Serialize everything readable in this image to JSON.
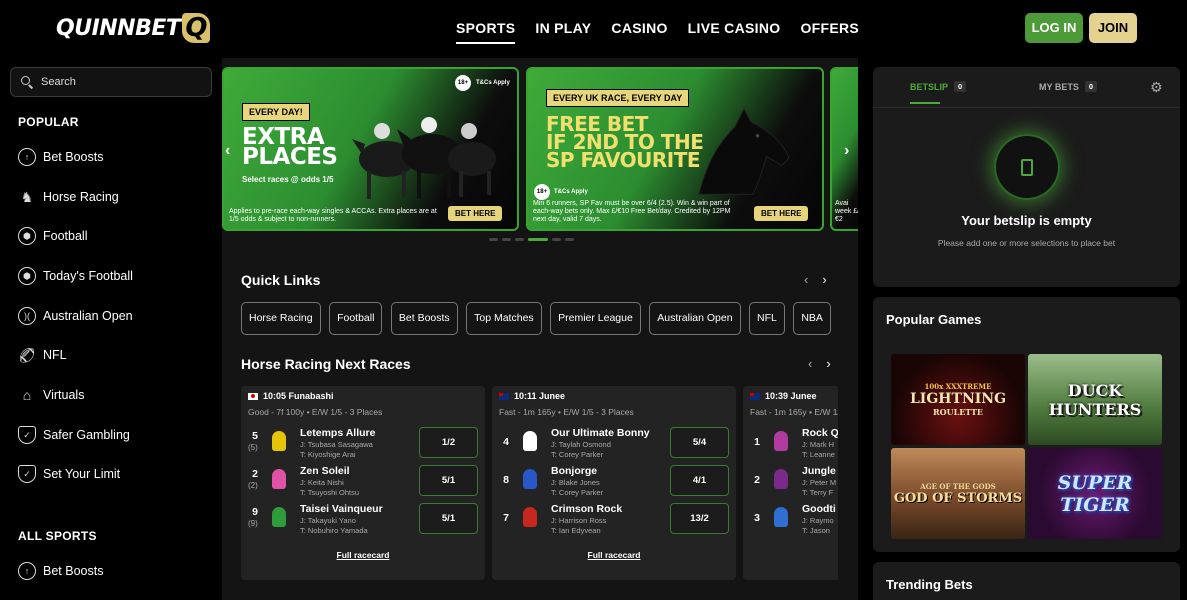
{
  "header": {
    "logo_text": "QUINNBET",
    "logo_letter": "Q",
    "nav": [
      "SPORTS",
      "IN PLAY",
      "CASINO",
      "LIVE CASINO",
      "OFFERS"
    ],
    "login_label": "LOG IN",
    "join_label": "JOIN",
    "accent_green": "#4c9a38",
    "accent_gold": "#e4d290"
  },
  "sidebar": {
    "search_placeholder": "Search",
    "popular_heading": "POPULAR",
    "popular_items": [
      {
        "label": "Bet Boosts",
        "icon": "boost-icon"
      },
      {
        "label": "Horse Racing",
        "icon": "horse-icon"
      },
      {
        "label": "Football",
        "icon": "football-icon"
      },
      {
        "label": "Today's Football",
        "icon": "football-icon"
      },
      {
        "label": "Australian Open",
        "icon": "tennis-icon"
      },
      {
        "label": "NFL",
        "icon": "american-football-icon"
      },
      {
        "label": "Virtuals",
        "icon": "virtuals-icon"
      },
      {
        "label": "Safer Gambling",
        "icon": "shield-icon"
      },
      {
        "label": "Set Your Limit",
        "icon": "shield-check-icon"
      }
    ],
    "all_sports_heading": "ALL SPORTS",
    "all_sports_items": [
      {
        "label": "Bet Boosts",
        "icon": "boost-icon"
      }
    ]
  },
  "banners": [
    {
      "tag": "EVERY DAY!",
      "title_line1": "EXTRA",
      "title_line2": "PLACES",
      "sub": "Select races @ odds 1/5",
      "terms": "Applies to pre-race each-way singles & ACCAs. Extra places are at 1/5 odds & subject to non-runners.",
      "button": "BET HERE",
      "age": "18+",
      "tc": "T&Cs Apply"
    },
    {
      "tag": "EVERY UK RACE, EVERY DAY",
      "title_line1": "FREE BET",
      "title_line2": "IF 2ND TO THE",
      "title_line3": "SP FAVOURITE",
      "terms": "Min 6 runners, SP Fav must be over 6/4 (2.5). Win & win part of each-way bets only. Max £/€10 Free Bet/day. Credited by 12PM next day, valid 7 days.",
      "button": "BET HERE",
      "age": "18+",
      "tc": "T&Cs Apply"
    },
    {
      "terms": "Avai week £/€2"
    }
  ],
  "quick_links": {
    "title": "Quick Links",
    "chips": [
      "Horse Racing",
      "Football",
      "Bet Boosts",
      "Top Matches",
      "Premier League",
      "Australian Open",
      "NFL",
      "NBA",
      "Gr"
    ]
  },
  "races": {
    "title": "Horse Racing Next Races",
    "cards": [
      {
        "time_venue": "10:05 Funabashi",
        "flag": "jp",
        "info": "Good  -  7f 100y   •   E/W 1/5 - 3 Places",
        "runners": [
          {
            "num": "5",
            "draw": "(5)",
            "name": "Letemps Allure",
            "jockey": "J: Tsubasa Sasagawa",
            "trainer": "T: Kiyoshige Arai",
            "odds": "1/2",
            "silk": "#e6c40a"
          },
          {
            "num": "2",
            "draw": "(2)",
            "name": "Zen Soleil",
            "jockey": "J: Keita Nishi",
            "trainer": "T: Tsuyoshi Ohtsu",
            "odds": "5/1",
            "silk": "#e052a8"
          },
          {
            "num": "9",
            "draw": "(9)",
            "name": "Taisei Vainqueur",
            "jockey": "J: Takayuki Yano",
            "trainer": "T: Nobuhiro Yamada",
            "odds": "5/1",
            "silk": "#2e9c3a"
          }
        ],
        "link": "Full racecard"
      },
      {
        "time_venue": "10:11 Junee",
        "flag": "au",
        "info": "Fast  -  1m 165y   •   E/W 1/5 - 3 Places",
        "runners": [
          {
            "num": "4",
            "draw": "",
            "name": "Our Ultimate Bonny",
            "jockey": "J: Taylah Osmond",
            "trainer": "T: Corey Parker",
            "odds": "5/4",
            "silk": "#ffffff"
          },
          {
            "num": "8",
            "draw": "",
            "name": "Bonjorge",
            "jockey": "J: Blake Jones",
            "trainer": "T: Corey Parker",
            "odds": "4/1",
            "silk": "#2a57c7"
          },
          {
            "num": "7",
            "draw": "",
            "name": "Crimson Rock",
            "jockey": "J: Harrison Ross",
            "trainer": "T: Ian Edyvean",
            "odds": "13/2",
            "silk": "#c7281e"
          }
        ],
        "link": "Full racecard"
      },
      {
        "time_venue": "10:39 Junee",
        "flag": "au",
        "info": "Fast  -  1m 165y   •   E/W 1/5 - 3 Places",
        "runners": [
          {
            "num": "1",
            "draw": "",
            "name": "Rock Q",
            "jockey": "J: Mark H",
            "trainer": "T: Leanne",
            "odds": "",
            "silk": "#b03aa0"
          },
          {
            "num": "2",
            "draw": "",
            "name": "Jungle",
            "jockey": "J: Peter M",
            "trainer": "T: Terry F",
            "odds": "",
            "silk": "#7a2a8a"
          },
          {
            "num": "3",
            "draw": "",
            "name": "Goodti",
            "jockey": "J: Raymo",
            "trainer": "T: Jason",
            "odds": "",
            "silk": "#2e6fd0"
          }
        ],
        "link": ""
      }
    ]
  },
  "betslip": {
    "tab_betslip": "BETSLIP",
    "betslip_count": "0",
    "tab_mybets": "MY BETS",
    "mybets_count": "0",
    "empty_title": "Your betslip is empty",
    "empty_msg": "Please add one or more selections to place bet"
  },
  "popular_games": {
    "title": "Popular Games",
    "games": [
      {
        "name": "Lightning Roulette",
        "label_small": "100x XXXTREME",
        "label_main": "LIGHTNING",
        "label_sub": "ROULETTE"
      },
      {
        "name": "Duck Hunters",
        "label_main": "DUCK HUNTERS"
      },
      {
        "name": "God of Storms",
        "label_small": "AGE OF THE GODS",
        "label_main": "GOD OF STORMS"
      },
      {
        "name": "Super Tiger",
        "label_main": "SUPER TIGER"
      }
    ]
  },
  "trending": {
    "title": "Trending Bets"
  }
}
